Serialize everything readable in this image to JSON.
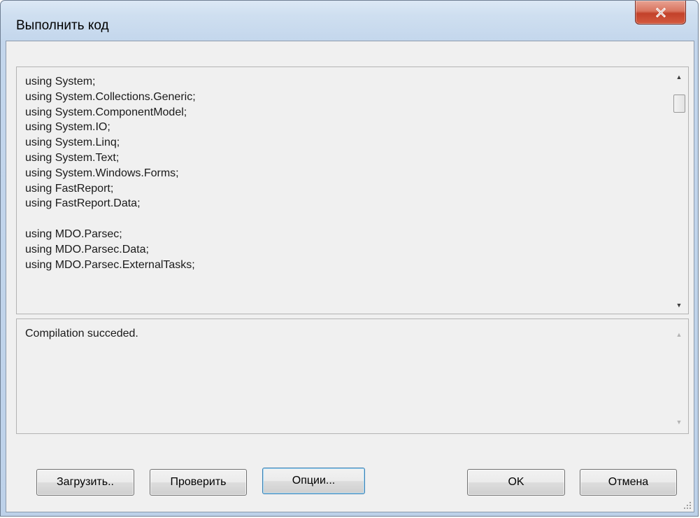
{
  "window": {
    "title": "Выполнить код",
    "close_symbol": "x"
  },
  "code_editor": {
    "lines": "using System;\nusing System.Collections.Generic;\nusing System.ComponentModel;\nusing System.IO;\nusing System.Linq;\nusing System.Text;\nusing System.Windows.Forms;\nusing FastReport;\nusing FastReport.Data;\n\nusing MDO.Parsec;\nusing MDO.Parsec.Data;\nusing MDO.Parsec.ExternalTasks;"
  },
  "output": {
    "message": "Compilation succeded."
  },
  "buttons": {
    "load": "Загрузить..",
    "check": "Проверить",
    "options": "Опции...",
    "ok": "OK",
    "cancel": "Отмена"
  },
  "icons": {
    "close": "close-icon",
    "scroll_up": "scroll-up-arrow-icon",
    "scroll_down": "scroll-down-arrow-icon",
    "size_grip": "size-grip-icon"
  },
  "colors": {
    "close_button": "#c2412a",
    "dialog_background": "#f0f0f0",
    "frame": "#bdd1e9"
  }
}
